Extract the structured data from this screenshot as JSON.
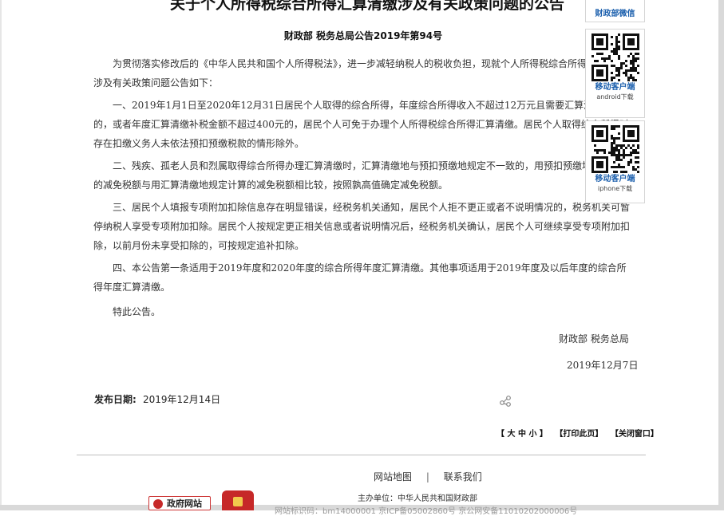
{
  "article": {
    "title": "关于个人所得税综合所得汇算清缴涉及有关政策问题的公告",
    "doc_number": "财政部 税务总局公告2019年第94号",
    "paragraphs": [
      "为贯彻落实修改后的《中华人民共和国个人所得税法》，进一步减轻纳税人的税收负担，现就个人所得税综合所得汇算清缴涉及有关政策问题公告如下：",
      "一、2019年1月1日至2020年12月31日居民个人取得的综合所得，年度综合所得收入不超过12万元且需要汇算清缴补税的，或者年度汇算清缴补税金额不超过400元的，居民个人可免于办理个人所得税综合所得汇算清缴。居民个人取得综合所得时存在扣缴义务人未依法预扣预缴税款的情形除外。",
      "二、残疾、孤老人员和烈属取得综合所得办理汇算清缴时，汇算清缴地与预扣预缴地规定不一致的，用预扣预缴地规定计算的减免税额与用汇算清缴地规定计算的减免税额相比较，按照孰高值确定减免税额。",
      "三、居民个人填报专项附加扣除信息存在明显错误，经税务机关通知，居民个人拒不更正或者不说明情况的，税务机关可暂停纳税人享受专项附加扣除。居民个人按规定更正相关信息或者说明情况后，经税务机关确认，居民个人可继续享受专项附加扣除，以前月份未享受扣除的，可按规定追补扣除。",
      "四、本公告第一条适用于2019年度和2020年度的综合所得年度汇算清缴。其他事项适用于2019年度及以后年度的综合所得年度汇算清缴。",
      "特此公告。"
    ],
    "signer": "财政部 税务总局",
    "sign_date": "2019年12月7日"
  },
  "meta": {
    "publish_label": "发布日期:",
    "publish_date": "2019年12月14日"
  },
  "tools": {
    "font_size": "【 大 中 小 】",
    "print": "【打印此页】",
    "close": "【关闭窗口】"
  },
  "footer": {
    "site_map": "网站地图",
    "separator": "|",
    "contact": "联系我们",
    "sponsor": "主办单位：中华人民共和国财政部",
    "record": "网站标识码：bm14000001   京ICP备05002860号   京公网安备11010202000006号",
    "gov_badge": "政府网站"
  },
  "sidebar": {
    "wechat_label": "财政部微信",
    "android_label": "移动客户端",
    "android_sub": "android下载",
    "iphone_label": "移动客户端",
    "iphone_sub": "iphone下载"
  }
}
